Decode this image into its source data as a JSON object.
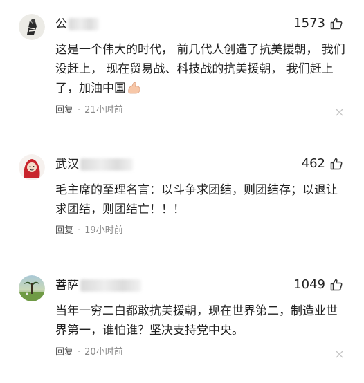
{
  "comments": [
    {
      "username": "公",
      "likes": "1573",
      "text": "这是一个伟大的时代， 前几代人创造了抗美援朝， 我们没赶上， 现在贸易战、科技战的抗美援朝， 我们赶上了，加油中国",
      "reply_label": "回复",
      "separator": "·",
      "time": "21小时前",
      "avatar_icon": "ink-figure-avatar",
      "emoji_icon": "flexed-biceps-emoji"
    },
    {
      "username": "武汉",
      "likes": "462",
      "text": "毛主席的至理名言：以斗争求团结，则团结存；以退让求团结，则团结亡！！！",
      "reply_label": "回复",
      "separator": "·",
      "time": "19小时前",
      "avatar_icon": "red-character-avatar"
    },
    {
      "username": "菩萨",
      "likes": "1049",
      "text": "当年一穷二白都敢抗美援朝，现在世界第二，制造业世界第一，谁怕谁？坚决支持党中央。",
      "reply_label": "回复",
      "separator": "·",
      "time": "20小时前",
      "avatar_icon": "green-tree-avatar"
    }
  ],
  "icons": {
    "like": "thumbs-up-icon",
    "close": "close-icon"
  },
  "colors": {
    "text": "#222222",
    "meta": "#888888",
    "avatar2_red": "#c8242b"
  }
}
